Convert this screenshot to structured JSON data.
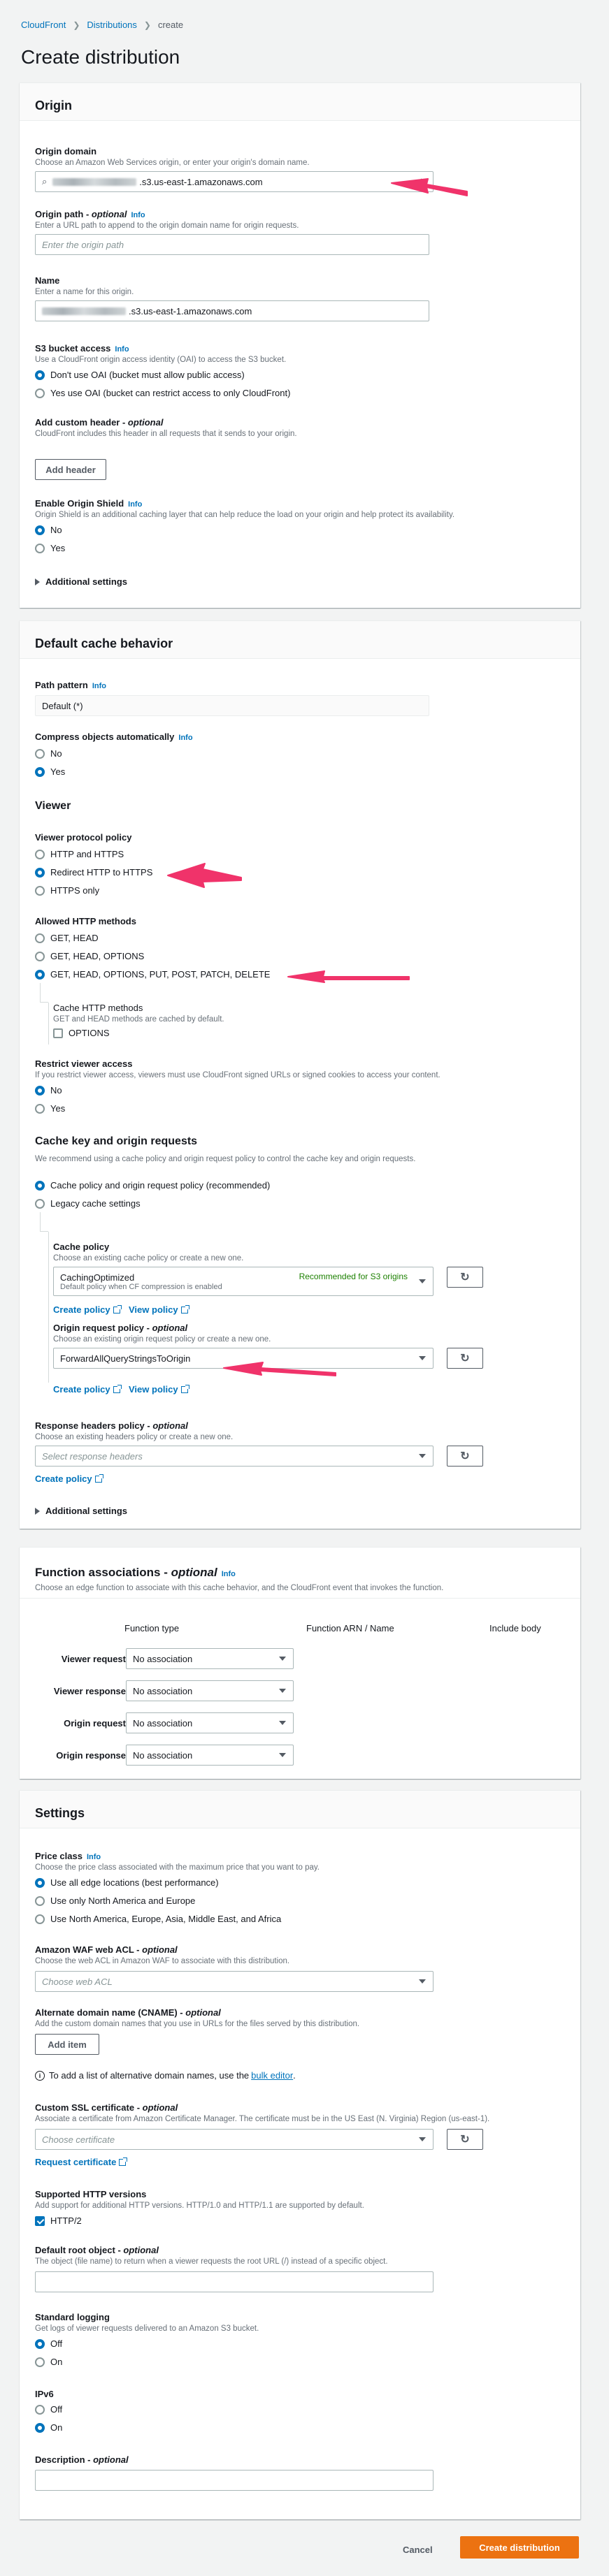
{
  "breadcrumb": {
    "items": [
      "CloudFront",
      "Distributions",
      "create"
    ]
  },
  "page_title": "Create distribution",
  "info": "Info",
  "colors": {
    "accent": "#0073bb",
    "primary": "#ec7211",
    "annotation": "#f0336a",
    "success": "#1d8102"
  },
  "origin": {
    "title": "Origin",
    "domain_label": "Origin domain",
    "domain_desc": "Choose an Amazon Web Services origin, or enter your origin's domain name.",
    "domain_value": ".s3.us-east-1.amazonaws.com",
    "path_label": "Origin path - ",
    "path_optional": "optional",
    "path_desc": "Enter a URL path to append to the origin domain name for origin requests.",
    "path_placeholder": "Enter the origin path",
    "name_label": "Name",
    "name_desc": "Enter a name for this origin.",
    "name_value": ".s3.us-east-1.amazonaws.com",
    "s3_label": "S3 bucket access",
    "s3_desc": "Use a CloudFront origin access identity (OAI) to access the S3 bucket.",
    "s3_opt1": "Don't use OAI (bucket must allow public access)",
    "s3_opt2": "Yes use OAI (bucket can restrict access to only CloudFront)",
    "header_label": "Add custom header - ",
    "header_optional": "optional",
    "header_desc": "CloudFront includes this header in all requests that it sends to your origin.",
    "header_button": "Add header",
    "shield_label": "Enable Origin Shield",
    "shield_desc": "Origin Shield is an additional caching layer that can help reduce the load on your origin and help protect its availability.",
    "shield_no": "No",
    "shield_yes": "Yes",
    "additional": "Additional settings"
  },
  "cache": {
    "title": "Default cache behavior",
    "path_label": "Path pattern",
    "path_value": "Default (*)",
    "compress_label": "Compress objects automatically",
    "compress_no": "No",
    "compress_yes": "Yes",
    "viewer_heading": "Viewer",
    "protocol_label": "Viewer protocol policy",
    "protocol_opts": [
      "HTTP and HTTPS",
      "Redirect HTTP to HTTPS",
      "HTTPS only"
    ],
    "methods_label": "Allowed HTTP methods",
    "methods_opts": [
      "GET, HEAD",
      "GET, HEAD, OPTIONS",
      "GET, HEAD, OPTIONS, PUT, POST, PATCH, DELETE"
    ],
    "cache_methods_label": "Cache HTTP methods",
    "cache_methods_desc": "GET and HEAD methods are cached by default.",
    "cache_methods_opt": "OPTIONS",
    "restrict_label": "Restrict viewer access",
    "restrict_desc": "If you restrict viewer access, viewers must use CloudFront signed URLs or signed cookies to access your content.",
    "restrict_no": "No",
    "restrict_yes": "Yes",
    "key_heading": "Cache key and origin requests",
    "key_desc": "We recommend using a cache policy and origin request policy to control the cache key and origin requests.",
    "key_opt1": "Cache policy and origin request policy (recommended)",
    "key_opt2": "Legacy cache settings",
    "cp_label": "Cache policy",
    "cp_desc": "Choose an existing cache policy or create a new one.",
    "cp_value": "CachingOptimized",
    "cp_sub": "Default policy when CF compression is enabled",
    "cp_recommended": "Recommended for S3 origins",
    "create_policy": "Create policy",
    "view_policy": "View policy",
    "orp_label": "Origin request policy - ",
    "orp_optional": "optional",
    "orp_desc": "Choose an existing origin request policy or create a new one.",
    "orp_value": "ForwardAllQueryStringsToOrigin",
    "rhp_label": "Response headers policy - ",
    "rhp_optional": "optional",
    "rhp_desc": "Choose an existing headers policy or create a new one.",
    "rhp_placeholder": "Select response headers",
    "additional": "Additional settings"
  },
  "functions": {
    "title": "Function associations - ",
    "title_optional": "optional",
    "desc": "Choose an edge function to associate with this cache behavior, and the CloudFront event that invokes the function.",
    "col_type": "Function type",
    "col_arn": "Function ARN / Name",
    "col_body": "Include body",
    "rows": [
      {
        "label": "Viewer request",
        "value": "No association"
      },
      {
        "label": "Viewer response",
        "value": "No association"
      },
      {
        "label": "Origin request",
        "value": "No association"
      },
      {
        "label": "Origin response",
        "value": "No association"
      }
    ]
  },
  "settings": {
    "title": "Settings",
    "price_label": "Price class",
    "price_desc": "Choose the price class associated with the maximum price that you want to pay.",
    "price_opts": [
      "Use all edge locations (best performance)",
      "Use only North America and Europe",
      "Use North America, Europe, Asia, Middle East, and Africa"
    ],
    "waf_label": "Amazon WAF web ACL - ",
    "waf_optional": "optional",
    "waf_desc": "Choose the web ACL in Amazon WAF to associate with this distribution.",
    "waf_placeholder": "Choose web ACL",
    "cname_label": "Alternate domain name (CNAME) - ",
    "cname_optional": "optional",
    "cname_desc": "Add the custom domain names that you use in URLs for the files served by this distribution.",
    "cname_button": "Add item",
    "cname_note": "To add a list of alternative domain names, use the ",
    "cname_note_link": "bulk editor",
    "ssl_label": "Custom SSL certificate - ",
    "ssl_optional": "optional",
    "ssl_desc": "Associate a certificate from Amazon Certificate Manager. The certificate must be in the US East (N. Virginia) Region (us-east-1).",
    "ssl_placeholder": "Choose certificate",
    "request_cert": "Request certificate",
    "http_label": "Supported HTTP versions",
    "http_desc": "Add support for additional HTTP versions. HTTP/1.0 and HTTP/1.1 are supported by default.",
    "http_opt": "HTTP/2",
    "root_label": "Default root object - ",
    "root_optional": "optional",
    "root_desc": "The object (file name) to return when a viewer requests the root URL (/) instead of a specific object.",
    "logging_label": "Standard logging",
    "logging_desc": "Get logs of viewer requests delivered to an Amazon S3 bucket.",
    "logging_off": "Off",
    "logging_on": "On",
    "ipv6_label": "IPv6",
    "ipv6_off": "Off",
    "ipv6_on": "On",
    "description_label": "Description - ",
    "description_optional": "optional"
  },
  "footer": {
    "cancel": "Cancel",
    "create": "Create distribution"
  }
}
